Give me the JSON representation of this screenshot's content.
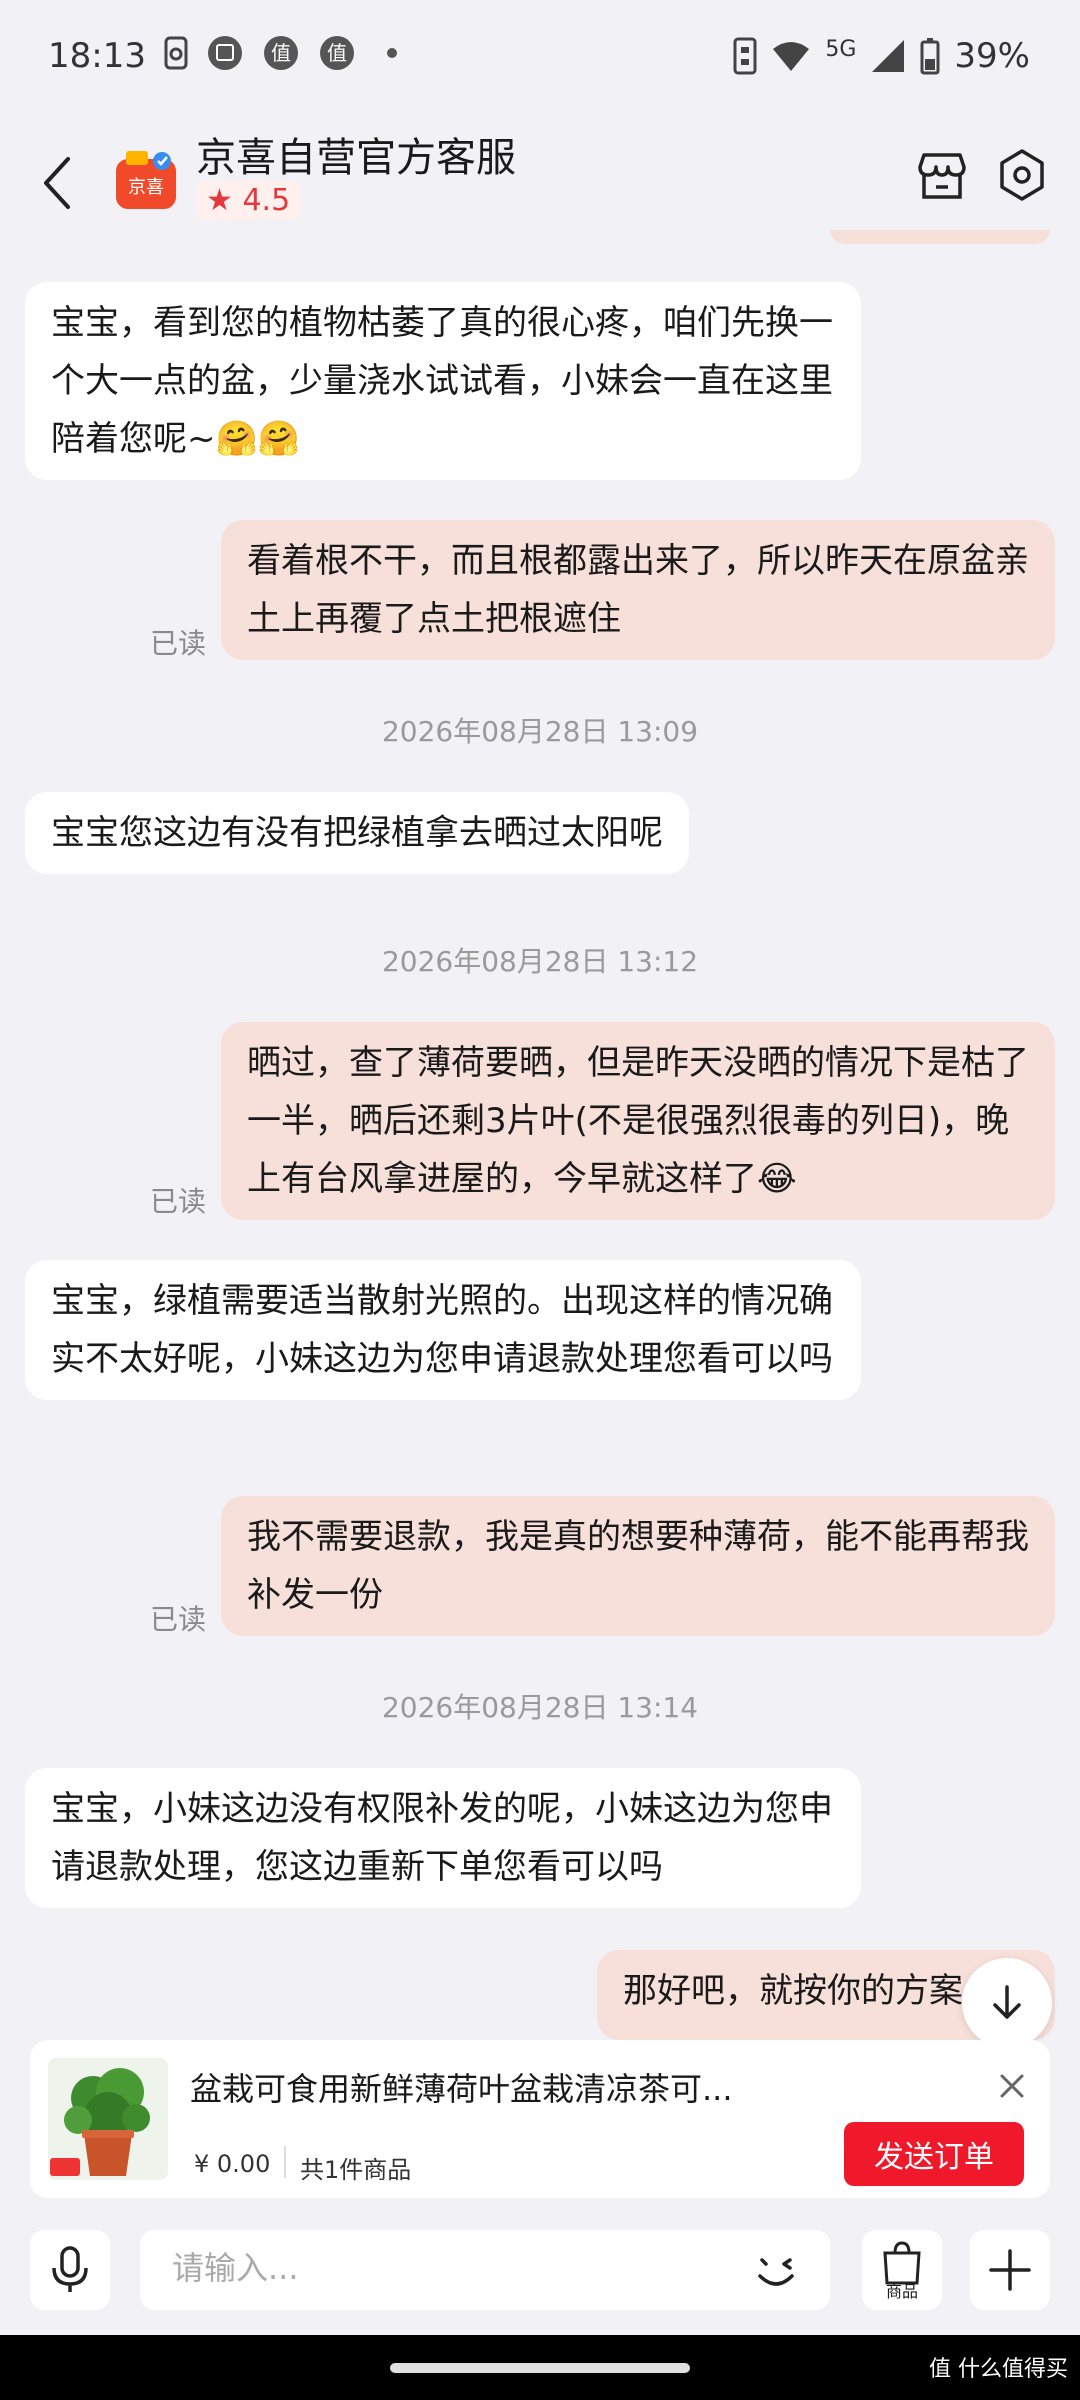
{
  "status_bar": {
    "time": "18:13",
    "network": "5G",
    "battery": "39%"
  },
  "header": {
    "title": "京喜自营官方客服",
    "rating": "4.5",
    "logo_text": "京喜"
  },
  "messages": [
    {
      "dir": "in",
      "text": "宝宝，看到您的植物枯萎了真的很心疼，咱们先换一个大一点的盆，少量浇水试试看，小妹会一直在这里陪着您呢~🤗🤗"
    },
    {
      "dir": "out",
      "text": "看着根不干，而且根都露出来了，所以昨天在原盆亲土上再覆了点土把根遮住",
      "read": "已读"
    },
    {
      "dir": "ts",
      "text": "2026年08月28日 13:09"
    },
    {
      "dir": "in",
      "text": "宝宝您这边有没有把绿植拿去晒过太阳呢"
    },
    {
      "dir": "ts",
      "text": "2026年08月28日 13:12"
    },
    {
      "dir": "out",
      "text": "晒过，查了薄荷要晒，但是昨天没晒的情况下是枯了一半，晒后还剩3片叶(不是很强烈很毒的列日)，晚上有台风拿进屋的，今早就这样了😂",
      "read": "已读"
    },
    {
      "dir": "in",
      "text": "宝宝，绿植需要适当散射光照的。出现这样的情况确实不太好呢，小妹这边为您申请退款处理您看可以吗"
    },
    {
      "dir": "out",
      "text": "我不需要退款，我是真的想要种薄荷，能不能再帮我补发一份",
      "read": "已读"
    },
    {
      "dir": "ts",
      "text": "2026年08月28日 13:14"
    },
    {
      "dir": "in",
      "text": "宝宝，小妹这边没有权限补发的呢，小妹这边为您申请退款处理，您这边重新下单您看可以吗"
    },
    {
      "dir": "out",
      "text": "那好吧，就按你的方案"
    }
  ],
  "product_card": {
    "name": "盆栽可食用新鲜薄荷叶盆栽清凉茶可...",
    "price": "¥ 0.00",
    "count": "共1件商品",
    "send_label": "发送订单"
  },
  "input_bar": {
    "placeholder": "请输入...",
    "goods_label": "商品"
  },
  "watermark": "值 什么值得买",
  "colors": {
    "accent": "#f0192c",
    "outgoing_bubble": "#f7e0da",
    "incoming_bubble": "#ffffff",
    "background": "#f2f2f6"
  }
}
